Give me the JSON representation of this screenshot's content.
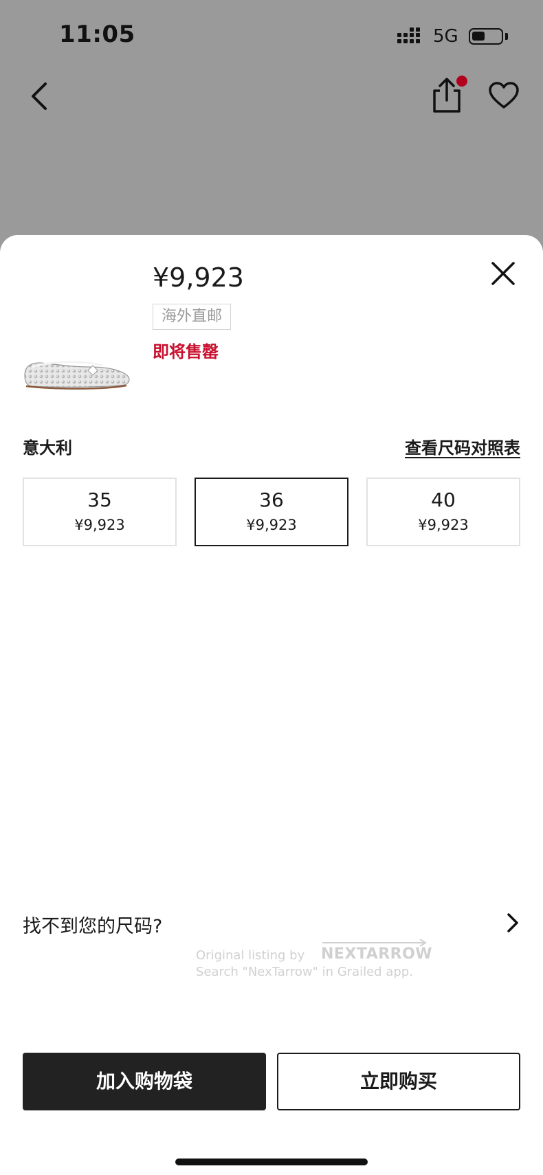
{
  "status_bar": {
    "time": "11:05",
    "network": "5G",
    "battery_fraction": 0.45
  },
  "nav": {
    "back_icon": "chevron-left-icon",
    "share_icon": "share-icon",
    "favorite_icon": "heart-icon",
    "notification_dot_color": "#b0001e"
  },
  "product": {
    "price": "¥9,923",
    "shipping_tag": "海外直邮",
    "stock_warning": "即将售罄",
    "stock_warning_color": "#c8102e"
  },
  "size_selector": {
    "region_label": "意大利",
    "size_chart_link": "查看尺码对照表",
    "sizes": [
      {
        "size": "35",
        "price": "¥9,923",
        "selected": false
      },
      {
        "size": "36",
        "price": "¥9,923",
        "selected": true
      },
      {
        "size": "40",
        "price": "¥9,923",
        "selected": false
      }
    ]
  },
  "find_size": {
    "label": "找不到您的尺码?"
  },
  "watermark": {
    "line1": "Original listing by",
    "logo": "NEXTARROW",
    "line2": "Search \"NexTarrow\" in Grailed app."
  },
  "actions": {
    "add_to_cart": "加入购物袋",
    "buy_now": "立即购买",
    "add_to_cart_bg": "#222222"
  }
}
